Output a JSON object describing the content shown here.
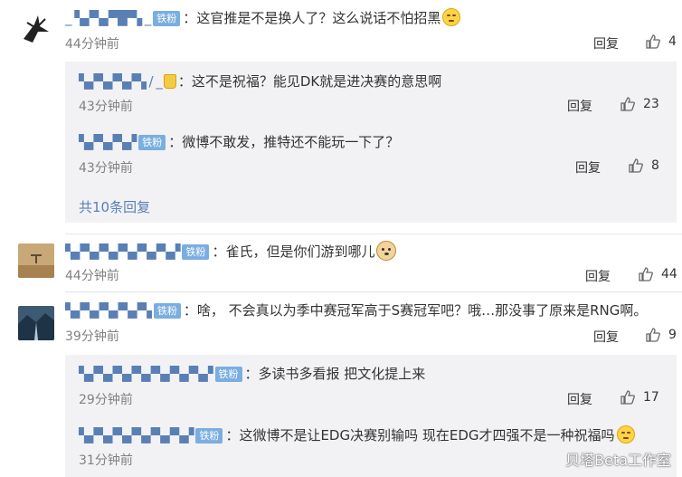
{
  "comments": [
    {
      "username": "_ ▚▞▚▞▜▛▚ _",
      "badge": "铁粉",
      "sep": "：",
      "text": "这官推是不是换人了？这么说话不怕招黑",
      "time": "44分钟前",
      "reply": "回复",
      "likes": "4",
      "replies": [
        {
          "username": "▚▞▚▞▚▞▚ / _",
          "badge": "",
          "sep": "：",
          "text": "这不是祝福？能见DK就是进决赛的意思啊",
          "time": "43分钟前",
          "reply": "回复",
          "likes": "23"
        },
        {
          "username": "▚▞▚▞▚▞",
          "badge": "铁粉",
          "sep": "：",
          "text": "微博不敢发，推特还不能玩一下了？",
          "time": "43分钟前",
          "reply": "回复",
          "likes": "8"
        }
      ],
      "more_replies": "共10条回复"
    },
    {
      "username": "▚▞▚▞▚▞▚▞▚▞▚▞",
      "badge": "铁粉",
      "sep": "：",
      "text": "雀氏，但是你们游到哪儿",
      "time": "44分钟前",
      "reply": "回复",
      "likes": "44"
    },
    {
      "username": "▚▞▚▞▚▞▚▞▚",
      "badge": "铁粉",
      "sep": "：",
      "text": "啥， 不会真以为季中赛冠军高于S赛冠军吧？哦…那没事了原来是RNG啊。",
      "time": "39分钟前",
      "reply": "回复",
      "likes": "9",
      "replies": [
        {
          "username": "▚▞▚▞▚▞▚▞▚▞▚▞▚▞",
          "badge": "铁粉",
          "sep": "：",
          "text": "多读书多看报 把文化提上来",
          "time": "29分钟前",
          "reply": "回复",
          "likes": "17"
        },
        {
          "username": "▚▞▚▞▚▞▚▞▚▞▚▞",
          "badge": "铁粉",
          "sep": "：",
          "text": "这微博不是让EDG决赛别输吗 现在EDG才四强不是一种祝福吗",
          "time": "31分钟前",
          "reply": "",
          "likes": ""
        }
      ]
    }
  ],
  "watermark": "贝塔Beta工作室",
  "colors": {
    "badge": "#7aaee0",
    "link": "#5a7fb5",
    "subbox": "#f2f2f5"
  }
}
